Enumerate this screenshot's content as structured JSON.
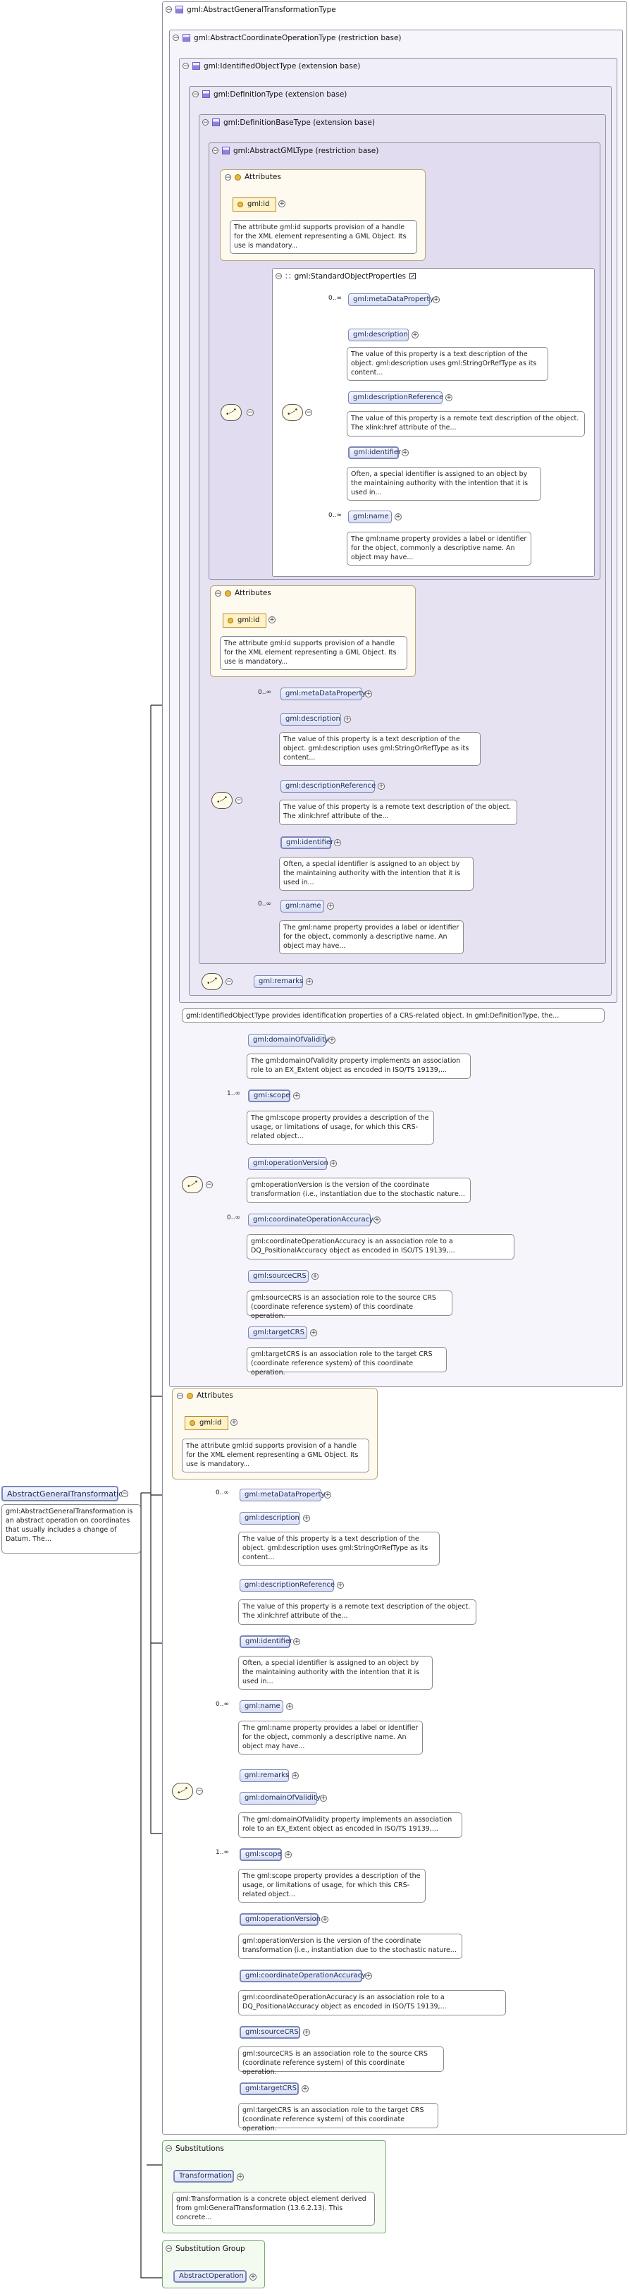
{
  "root": {
    "name": "AbstractGeneralTransformation",
    "doc": "gml:AbstractGeneralTransformation is an abstract operation on coordinates that usually includes a change of Datum. The..."
  },
  "type_chain": {
    "t1": "gml:AbstractGeneralTransformationType",
    "t2": "gml:AbstractCoordinateOperationType (restriction base)",
    "t3": "gml:IdentifiedObjectType (extension base)",
    "t4": "gml:DefinitionType (extension base)",
    "t5": "gml:DefinitionBaseType (extension base)",
    "t6": "gml:AbstractGMLType (restriction base)",
    "std_props": "gml:StandardObjectProperties"
  },
  "labels": {
    "attributes": "Attributes",
    "substitutions": "Substitutions",
    "substitution_group": "Substitution Group",
    "card_0_inf": "0..∞",
    "card_1_inf": "1..∞"
  },
  "attr_gml_id": {
    "name": "gml:id",
    "doc": "The attribute gml:id supports provision of a handle for the XML element representing a GML Object. Its use is mandatory..."
  },
  "elements": {
    "metaDataProperty": {
      "name": "gml:metaDataProperty"
    },
    "description": {
      "name": "gml:description",
      "doc": "The value of this property is a text description of the object. gml:description uses gml:StringOrRefType as its content..."
    },
    "descriptionReference": {
      "name": "gml:descriptionReference",
      "doc": "The value of this property is a remote text description of the object. The xlink:href attribute of the..."
    },
    "identifier": {
      "name": "gml:identifier",
      "doc": "Often, a special identifier is assigned to an object by the maintaining authority with the intention that it is used in..."
    },
    "name": {
      "name": "gml:name",
      "doc": "The gml:name property provides a label or identifier for the object, commonly a descriptive name. An object may have..."
    },
    "remarks": {
      "name": "gml:remarks"
    },
    "domainOfValidity": {
      "name": "gml:domainOfValidity",
      "doc": "The gml:domainOfValidity property implements an association role to an EX_Extent object as encoded in ISO/TS 19139,..."
    },
    "scope": {
      "name": "gml:scope",
      "doc": "The gml:scope property provides a description of the usage, or limitations of usage, for which this CRS-related object..."
    },
    "operationVersion": {
      "name": "gml:operationVersion",
      "doc": "gml:operationVersion is the version of the coordinate transformation (i.e., instantiation due to the stochastic nature..."
    },
    "coordinateOperationAccuracy": {
      "name": "gml:coordinateOperationAccuracy",
      "doc": "gml:coordinateOperationAccuracy is an association role to a DQ_PositionalAccuracy object as encoded in ISO/TS 19139,..."
    },
    "sourceCRS": {
      "name": "gml:sourceCRS",
      "doc": "gml:sourceCRS is an association role to the source CRS (coordinate reference system) of this coordinate operation."
    },
    "targetCRS": {
      "name": "gml:targetCRS",
      "doc": "gml:targetCRS is an association role to the target CRS (coordinate reference system) of this coordinate operation."
    }
  },
  "identified_doc": "gml:IdentifiedObjectType provides identification properties of a CRS-related object. In gml:DefinitionType, the...",
  "substitutions": {
    "transformation": "Transformation",
    "transformation_doc": "gml:Transformation is a concrete object element derived from gml:GeneralTransformation (13.6.2.13). This concrete...",
    "abstract_operation": "AbstractOperation"
  }
}
